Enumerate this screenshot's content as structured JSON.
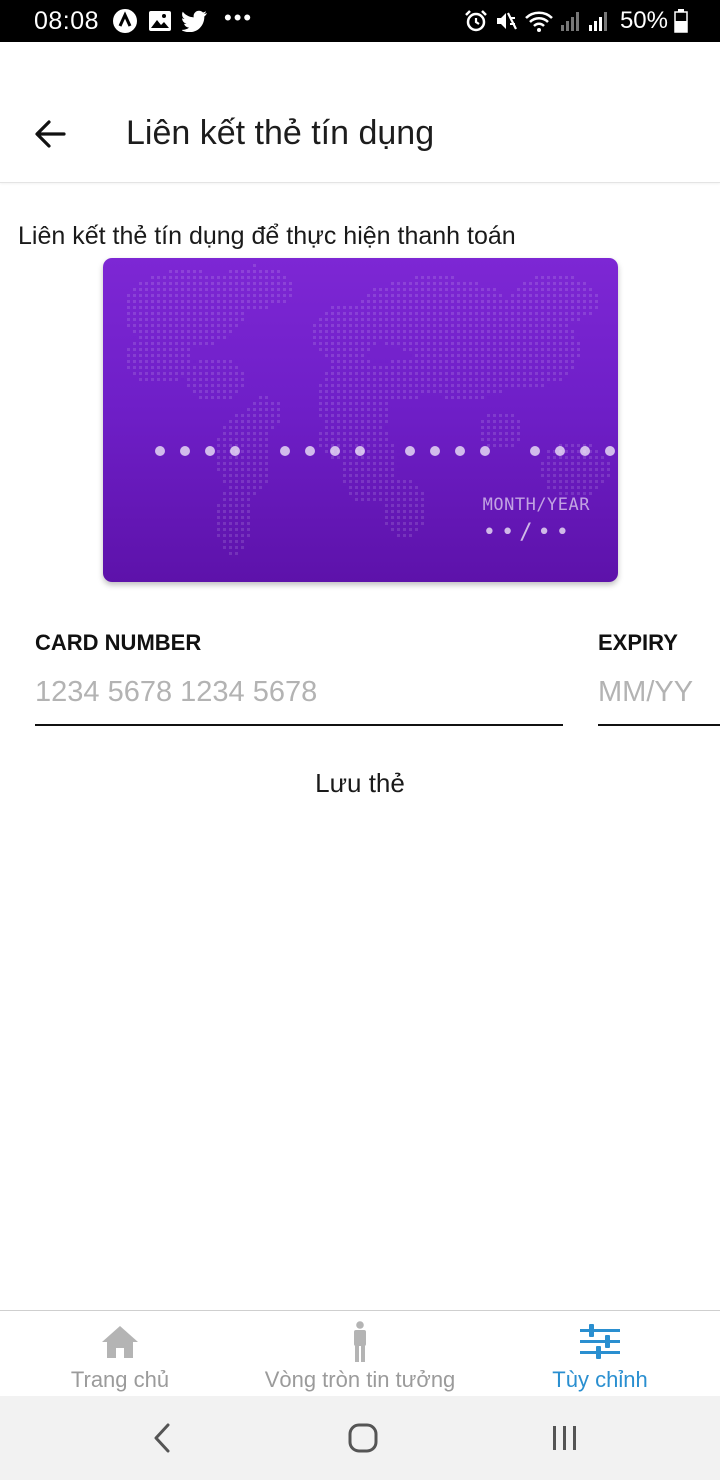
{
  "status_bar": {
    "time": "08:08",
    "left_icons": [
      "react-icon",
      "gallery-icon",
      "twitter-icon"
    ],
    "more": "•••",
    "battery_percent": "50%"
  },
  "header": {
    "title": "Liên kết thẻ tín dụng"
  },
  "intro_text": "Liên kết thẻ tín dụng để thực hiện thanh toán",
  "card": {
    "expiry_label": "MONTH/YEAR",
    "expiry_value": "••/••",
    "gradient_top": "#7d27d4",
    "gradient_bottom": "#5d12aa"
  },
  "form": {
    "card_number": {
      "label": "CARD NUMBER",
      "placeholder": "1234 5678 1234 5678",
      "value": ""
    },
    "expiry": {
      "label": "EXPIRY",
      "placeholder": "MM/YY",
      "value": ""
    }
  },
  "save_label": "Lưu thẻ",
  "tabs": [
    {
      "label": "Trang chủ",
      "icon": "home-icon",
      "active": false
    },
    {
      "label": "Vòng tròn tin tưởng",
      "icon": "person-icon",
      "active": false
    },
    {
      "label": "Tùy chỉnh",
      "icon": "settings-sliders-icon",
      "active": true
    }
  ],
  "colors": {
    "accent": "#2a8fd0",
    "inactive": "#9b9b9b",
    "card_purple": "#6f1fc8"
  },
  "system_nav": [
    "back-nav-icon",
    "home-nav-icon",
    "recents-nav-icon"
  ]
}
